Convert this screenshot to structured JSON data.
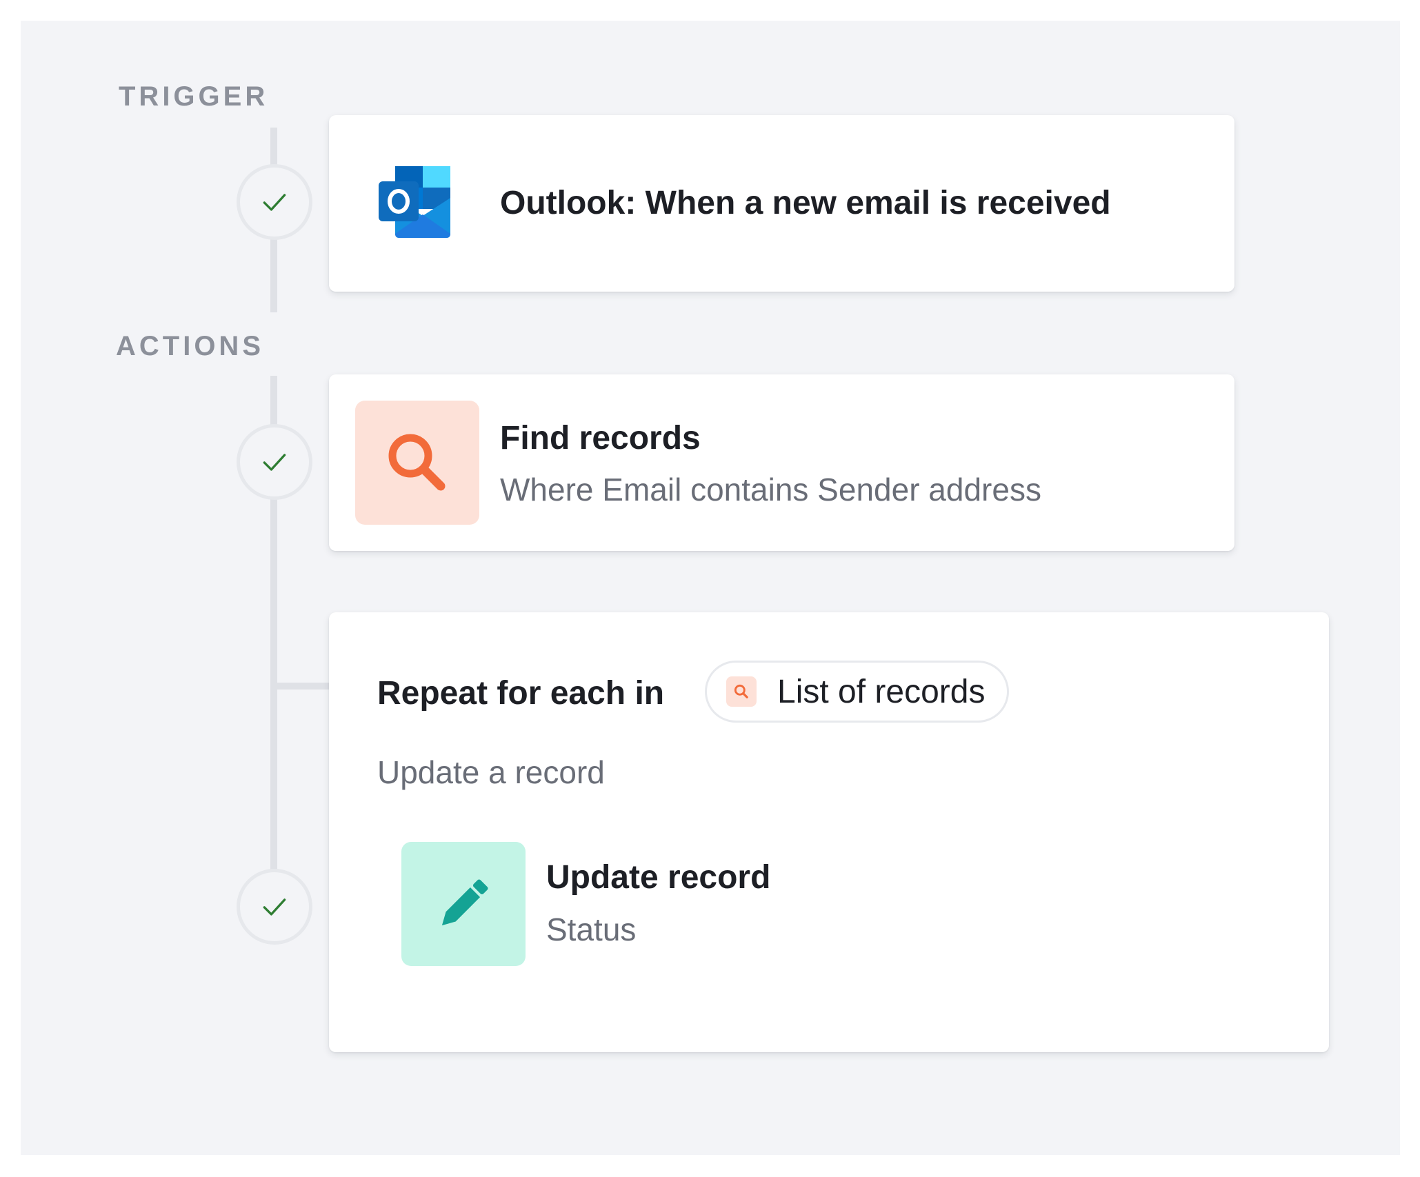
{
  "sections": {
    "trigger_label": "TRIGGER",
    "actions_label": "ACTIONS"
  },
  "trigger": {
    "app_icon": "outlook-icon",
    "title": "Outlook: When a new email is received",
    "status": "complete"
  },
  "find_records": {
    "app_icon": "search-icon",
    "title": "Find records",
    "subtitle": "Where Email contains Sender address",
    "status": "complete"
  },
  "repeat": {
    "prefix": "Repeat for each in",
    "source_icon": "search-icon",
    "source_label": "List of records",
    "description": "Update a record",
    "inner_step": {
      "app_icon": "pencil-icon",
      "title": "Update record",
      "subtitle": "Status",
      "status": "complete"
    }
  },
  "colors": {
    "canvas_bg": "#f3f4f7",
    "check_green": "#2e7d32",
    "search_orange": "#f26b3a",
    "search_tile_bg": "#fde1d8",
    "pencil_teal": "#14a394",
    "pencil_tile_bg": "#c3f4e6",
    "outlook_blue": "#0f6cbd"
  }
}
